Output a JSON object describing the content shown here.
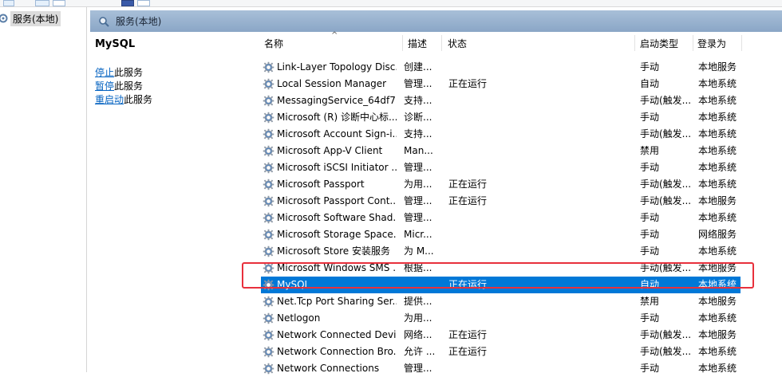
{
  "tree": {
    "root_label": "服务(本地)"
  },
  "pane": {
    "title": "服务(本地)"
  },
  "details": {
    "service_name": "MySQL",
    "stop_link": "停止",
    "stop_suffix": "此服务",
    "pause_link": "暂停",
    "pause_suffix": "此服务",
    "restart_link": "重启动",
    "restart_suffix": "此服务"
  },
  "columns": {
    "name": "名称",
    "desc": "描述",
    "status": "状态",
    "startup": "启动类型",
    "logon": "登录为"
  },
  "rows": [
    {
      "name": "Link-Layer Topology Disc...",
      "desc": "创建...",
      "status": "",
      "startup": "手动",
      "logon": "本地服务"
    },
    {
      "name": "Local Session Manager",
      "desc": "管理...",
      "status": "正在运行",
      "startup": "自动",
      "logon": "本地系统"
    },
    {
      "name": "MessagingService_64df7",
      "desc": "支持...",
      "status": "",
      "startup": "手动(触发...",
      "logon": "本地系统"
    },
    {
      "name": "Microsoft (R) 诊断中心标...",
      "desc": "诊断...",
      "status": "",
      "startup": "手动",
      "logon": "本地系统"
    },
    {
      "name": "Microsoft Account Sign-i...",
      "desc": "支持...",
      "status": "",
      "startup": "手动(触发...",
      "logon": "本地系统"
    },
    {
      "name": "Microsoft App-V Client",
      "desc": "Man...",
      "status": "",
      "startup": "禁用",
      "logon": "本地系统"
    },
    {
      "name": "Microsoft iSCSI Initiator ...",
      "desc": "管理...",
      "status": "",
      "startup": "手动",
      "logon": "本地系统"
    },
    {
      "name": "Microsoft Passport",
      "desc": "为用...",
      "status": "正在运行",
      "startup": "手动(触发...",
      "logon": "本地系统"
    },
    {
      "name": "Microsoft Passport Cont...",
      "desc": "管理...",
      "status": "正在运行",
      "startup": "手动(触发...",
      "logon": "本地服务"
    },
    {
      "name": "Microsoft Software Shad...",
      "desc": "管理...",
      "status": "",
      "startup": "手动",
      "logon": "本地系统"
    },
    {
      "name": "Microsoft Storage Space...",
      "desc": "Micr...",
      "status": "",
      "startup": "手动",
      "logon": "网络服务"
    },
    {
      "name": "Microsoft Store 安装服务",
      "desc": "为 M...",
      "status": "",
      "startup": "手动",
      "logon": "本地系统"
    },
    {
      "name": "Microsoft Windows SMS ...",
      "desc": "根据...",
      "status": "",
      "startup": "手动(触发...",
      "logon": "本地服务"
    },
    {
      "name": "MySQL",
      "desc": "",
      "status": "正在运行",
      "startup": "自动",
      "logon": "本地系统"
    },
    {
      "name": "Net.Tcp Port Sharing Ser...",
      "desc": "提供...",
      "status": "",
      "startup": "禁用",
      "logon": "本地服务"
    },
    {
      "name": "Netlogon",
      "desc": "为用...",
      "status": "",
      "startup": "手动",
      "logon": "本地系统"
    },
    {
      "name": "Network Connected Devi...",
      "desc": "网络...",
      "status": "正在运行",
      "startup": "手动(触发...",
      "logon": "本地服务"
    },
    {
      "name": "Network Connection Bro...",
      "desc": "允许 ...",
      "status": "正在运行",
      "startup": "手动(触发...",
      "logon": "本地系统"
    },
    {
      "name": "Network Connections",
      "desc": "管理...",
      "status": "",
      "startup": "手动",
      "logon": "本地系统"
    }
  ],
  "selected_index": 13,
  "colors": {
    "selection": "#0078d7",
    "highlight_box": "#e8303c",
    "header": "#8aa6c6"
  }
}
